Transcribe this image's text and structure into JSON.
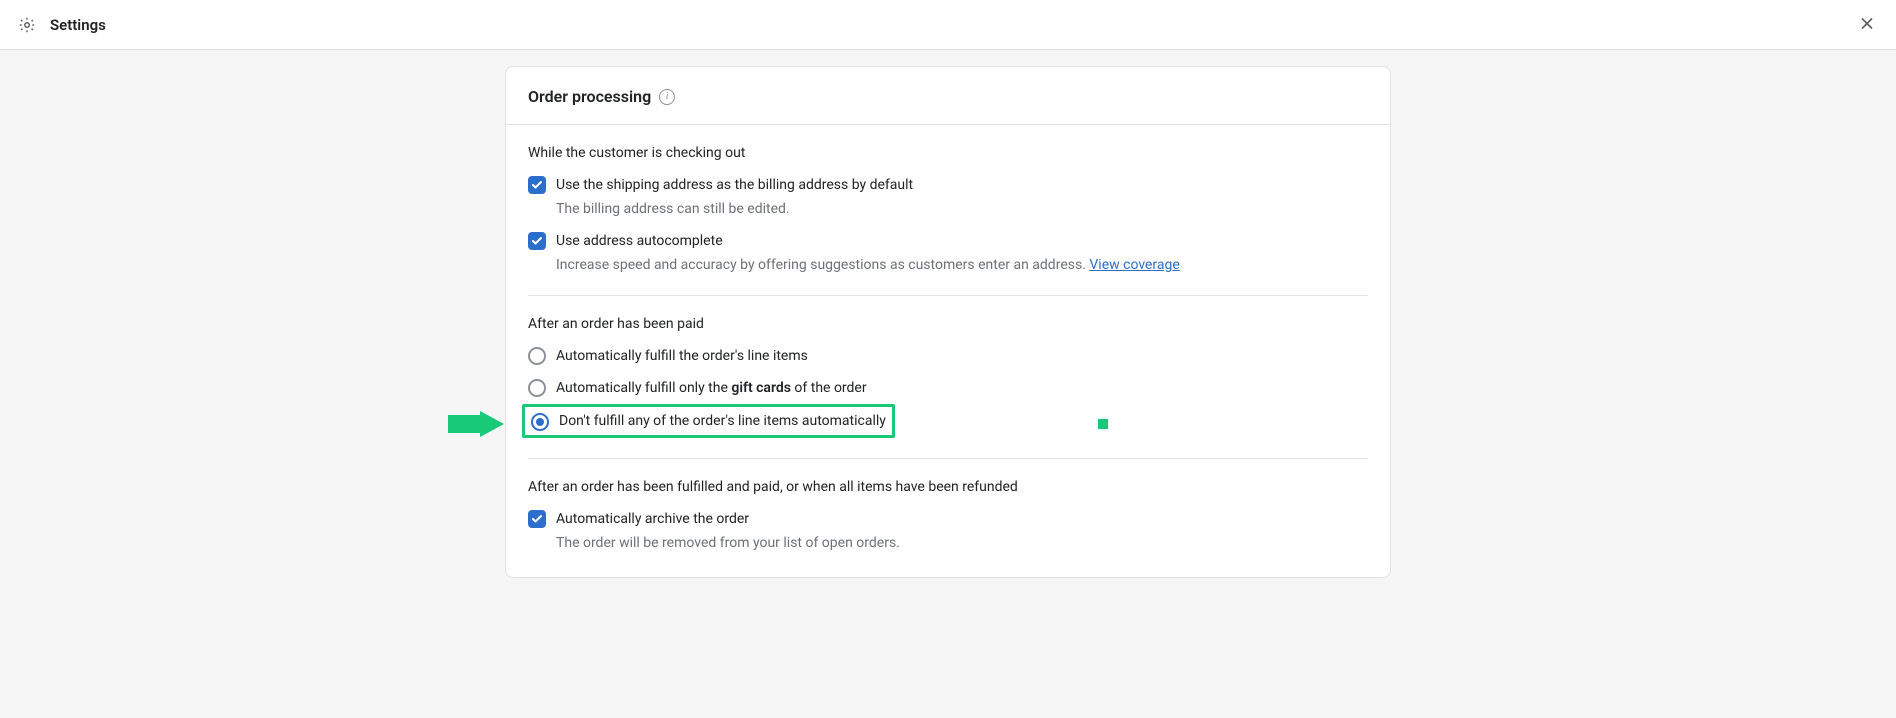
{
  "header": {
    "title": "Settings"
  },
  "card": {
    "title": "Order processing"
  },
  "section_checkout": {
    "subhead": "While the customer is checking out",
    "opt1": {
      "label": "Use the shipping address as the billing address by default",
      "desc": "The billing address can still be edited."
    },
    "opt2": {
      "label": "Use address autocomplete",
      "desc": "Increase speed and accuracy by offering suggestions as customers enter an address. ",
      "link": "View coverage"
    }
  },
  "section_paid": {
    "subhead": "After an order has been paid",
    "opt1": {
      "label": "Automatically fulfill the order's line items"
    },
    "opt2": {
      "prefix": "Automatically fulfill only the ",
      "bold": "gift cards",
      "suffix": " of the order"
    },
    "opt3": {
      "label": "Don't fulfill any of the order's line items automatically"
    }
  },
  "section_fulfilled": {
    "subhead": "After an order has been fulfilled and paid, or when all items have been refunded",
    "opt1": {
      "label": "Automatically archive the order",
      "desc": "The order will be removed from your list of open orders."
    }
  }
}
